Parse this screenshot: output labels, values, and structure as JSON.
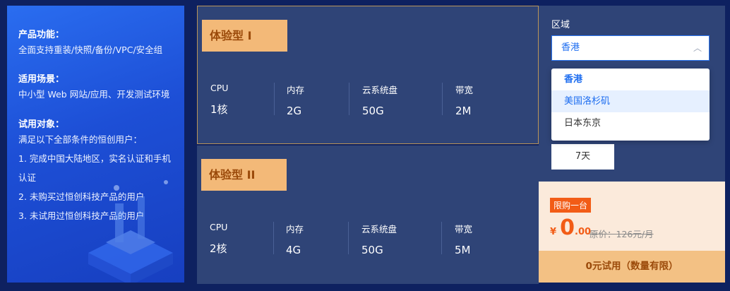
{
  "left_panel": {
    "features_heading": "产品功能：",
    "features_text": "全面支持重装/快照/备份/VPC/安全组",
    "scenario_heading": "适用场景：",
    "scenario_text": "中小型 Web 网站/应用、开发测试环境",
    "target_heading": "试用对象：",
    "target_intro": "满足以下全部条件的恒创用户：",
    "conditions": [
      "1. 完成中国大陆地区，实名认证和手机",
      "认证",
      "2. 未购买过恒创科技产品的用户",
      "3. 未试用过恒创科技产品的用户"
    ]
  },
  "plans": [
    {
      "name": "体验型 I",
      "specs": [
        {
          "label": "CPU",
          "value": "1核"
        },
        {
          "label": "内存",
          "value": "2G"
        },
        {
          "label": "云系统盘",
          "value": "50G"
        },
        {
          "label": "带宽",
          "value": "2M"
        }
      ]
    },
    {
      "name": "体验型 II",
      "specs": [
        {
          "label": "CPU",
          "value": "2核"
        },
        {
          "label": "内存",
          "value": "4G"
        },
        {
          "label": "云系统盘",
          "value": "50G"
        },
        {
          "label": "带宽",
          "value": "5M"
        }
      ]
    }
  ],
  "order_panel": {
    "region_label": "区域",
    "region_selected": "香港",
    "region_options": [
      "香港",
      "美国洛杉矶",
      "日本东京"
    ],
    "period_value": "7天",
    "limit_badge": "限购一台",
    "currency_symbol": "¥",
    "price_integer": "0",
    "price_decimal": ".00",
    "original_price": "原价：126元/月",
    "cta_label": "0元试用（数量有限）"
  },
  "colors": {
    "accent": "#f25c16",
    "tag_bg": "#f3b978",
    "card_bg": "#2f4477",
    "select_blue": "#1d6df0"
  }
}
